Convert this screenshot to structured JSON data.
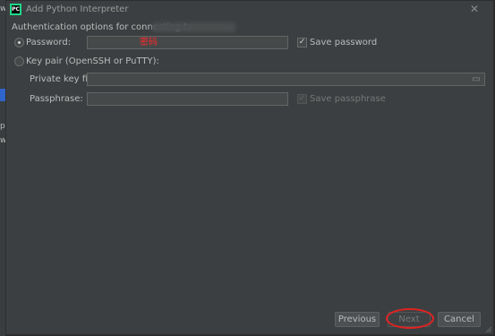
{
  "ide_fragments": [
    "w",
    "p",
    "w"
  ],
  "window": {
    "title": "Add Python Interpreter",
    "app_icon_text": "PC"
  },
  "heading": "Authentication options for connecting to",
  "password_option": {
    "label": "Password:",
    "selected": true,
    "value": "密码",
    "save_label": "Save password",
    "save_checked": true
  },
  "keypair_option": {
    "label": "Key pair (OpenSSH or PuTTY):",
    "selected": false,
    "private_key_label": "Private key file:",
    "private_key_value": "",
    "passphrase_label": "Passphrase:",
    "passphrase_value": "",
    "save_passphrase_label": "Save passphrase",
    "save_passphrase_checked": true
  },
  "buttons": {
    "previous": "Previous",
    "next": "Next",
    "cancel": "Cancel"
  },
  "colors": {
    "dialog_bg": "#3c3f41",
    "field_bg": "#45494a",
    "annotation": "#e22222",
    "ide_selection": "#2f65ca"
  },
  "icons": {
    "close": "close-icon",
    "folder": "folder-icon",
    "app": "pycharm-icon"
  }
}
